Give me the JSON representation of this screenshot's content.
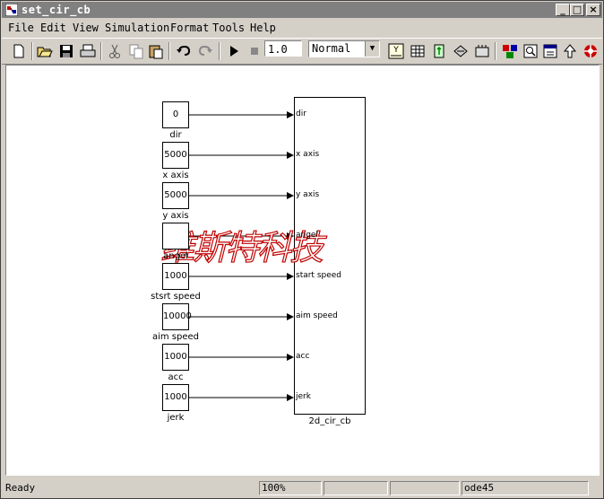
{
  "window": {
    "title": "set_cir_cb"
  },
  "menu": [
    "File",
    "Edit",
    "View",
    "Simulation",
    "Format",
    "Tools",
    "Help"
  ],
  "toolbar": {
    "stop_time": "1.0",
    "sim_mode": "Normal"
  },
  "canvas": {
    "constants": [
      {
        "value": "0",
        "label": "dir"
      },
      {
        "value": "5000",
        "label": "x axis"
      },
      {
        "value": "5000",
        "label": "y axis"
      },
      {
        "value": "",
        "label": "angel"
      },
      {
        "value": "1000",
        "label": "stsrt speed"
      },
      {
        "value": "10000",
        "label": "aim speed"
      },
      {
        "value": "1000",
        "label": "acc"
      },
      {
        "value": "1000",
        "label": "jerk"
      }
    ],
    "subsystem": {
      "name": "2d_cir_cb",
      "ports": [
        "dir",
        "x axis",
        "y axis",
        "angel",
        "start speed",
        "aim speed",
        "acc",
        "jerk"
      ]
    },
    "watermark": "维斯特科技"
  },
  "status": {
    "state": "Ready",
    "zoom": "100%",
    "solver": "ode45"
  }
}
